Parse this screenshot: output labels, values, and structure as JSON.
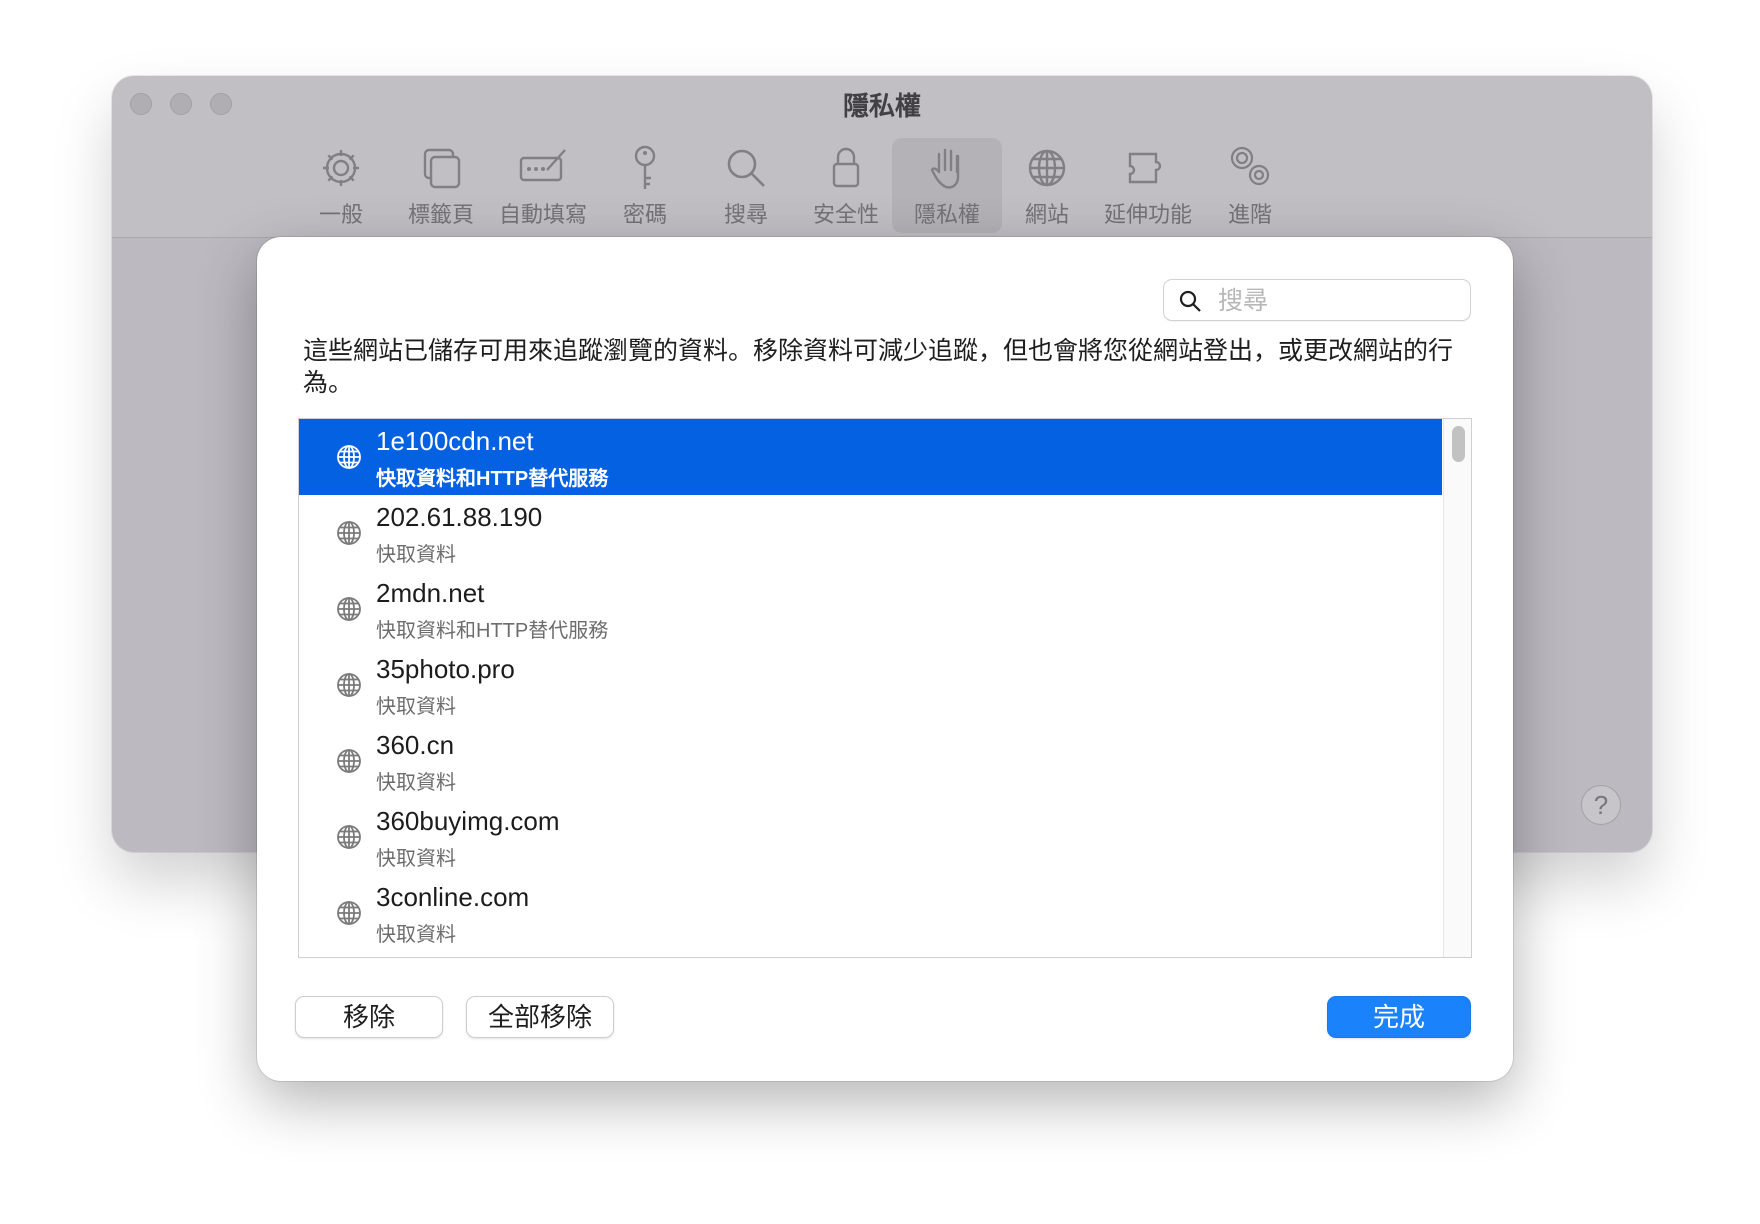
{
  "window": {
    "title": "隱私權",
    "toolbar": [
      {
        "label": "一般",
        "icon": "gear-icon",
        "active": false
      },
      {
        "label": "標籤頁",
        "icon": "tabs-icon",
        "active": false
      },
      {
        "label": "自動填寫",
        "icon": "autofill-icon",
        "active": false
      },
      {
        "label": "密碼",
        "icon": "key-icon",
        "active": false
      },
      {
        "label": "搜尋",
        "icon": "search-icon",
        "active": false
      },
      {
        "label": "安全性",
        "icon": "lock-icon",
        "active": false
      },
      {
        "label": "隱私權",
        "icon": "hand-icon",
        "active": true
      },
      {
        "label": "網站",
        "icon": "globe-icon",
        "active": false
      },
      {
        "label": "延伸功能",
        "icon": "puzzle-icon",
        "active": false
      },
      {
        "label": "進階",
        "icon": "gears-icon",
        "active": false
      }
    ],
    "help_label": "?"
  },
  "sheet": {
    "search": {
      "placeholder": "搜尋",
      "value": ""
    },
    "description": "這些網站已儲存可用來追蹤瀏覽的資料。移除資料可減少追蹤，但也會將您從網站登出，或更改網站的行為。",
    "sites": [
      {
        "name": "1e100cdn.net",
        "kind": "快取資料和HTTP替代服務",
        "selected": true
      },
      {
        "name": "202.61.88.190",
        "kind": "快取資料",
        "selected": false
      },
      {
        "name": "2mdn.net",
        "kind": "快取資料和HTTP替代服務",
        "selected": false
      },
      {
        "name": "35photo.pro",
        "kind": "快取資料",
        "selected": false
      },
      {
        "name": "360.cn",
        "kind": "快取資料",
        "selected": false
      },
      {
        "name": "360buyimg.com",
        "kind": "快取資料",
        "selected": false
      },
      {
        "name": "3conline.com",
        "kind": "快取資料",
        "selected": false
      }
    ],
    "buttons": {
      "remove": "移除",
      "remove_all": "全部移除",
      "done": "完成"
    }
  },
  "colors": {
    "selection": "#0461e1",
    "primary_button": "#1a82fb"
  }
}
